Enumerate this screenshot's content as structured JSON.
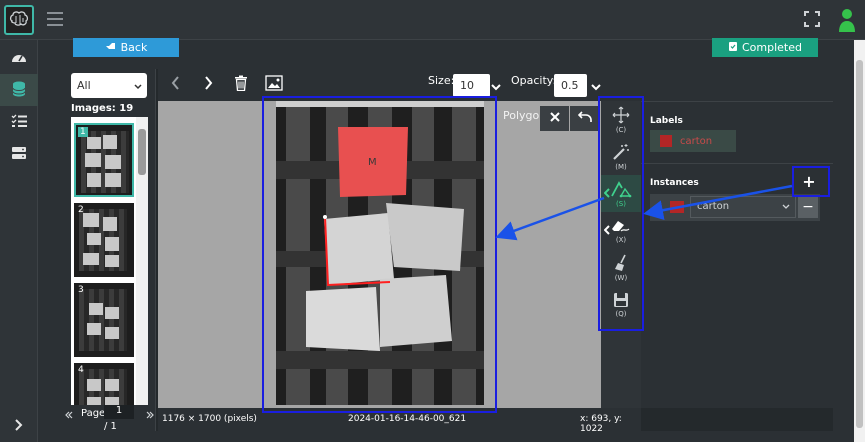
{
  "header": {
    "logo_icon": "brain-logo-icon",
    "menu_icon": "hamburger-icon",
    "fullscreen_icon": "fullscreen-icon",
    "user_icon": "user-icon"
  },
  "sidebar": {
    "items": [
      {
        "icon": "dashboard-icon"
      },
      {
        "icon": "database-icon",
        "active": true
      },
      {
        "icon": "task-list-icon"
      },
      {
        "icon": "server-icon"
      }
    ],
    "expand_icon": "chevron-right-icon"
  },
  "actions": {
    "back_label": "Back",
    "completed_label": "Completed"
  },
  "images_panel": {
    "filter_value": "All",
    "images_count_label": "Images: 19",
    "thumbnails": [
      {
        "num": "1"
      },
      {
        "num": "2"
      },
      {
        "num": "3"
      },
      {
        "num": "4"
      }
    ],
    "page_label": "Page",
    "page_value": "1",
    "page_total": "/ 1"
  },
  "toolbar": {
    "size_label": "Size:",
    "size_value": "10",
    "opacity_label": "Opacity:",
    "opacity_value": "0.5"
  },
  "canvas": {
    "polygon_label": "Polygon",
    "dimensions": "1176 × 1700 (pixels)",
    "filename": "2024-01-16-14-46-00_621",
    "coords": "x: 693, y: 1022"
  },
  "tools": [
    {
      "key": "(C)",
      "icon": "move-icon"
    },
    {
      "key": "(M)",
      "icon": "magic-wand-icon"
    },
    {
      "key": "(S)",
      "icon": "polygon-brush-icon",
      "active": true
    },
    {
      "key": "(X)",
      "icon": "eraser-icon"
    },
    {
      "key": "(W)",
      "icon": "broom-icon"
    },
    {
      "key": "(Q)",
      "icon": "save-icon"
    }
  ],
  "right_panel": {
    "labels_title": "Labels",
    "label_name": "carton",
    "label_color": "#b32626",
    "instances_title": "Instances",
    "instance_value": "carton"
  },
  "colors": {
    "accent": "#3fb8a8",
    "back": "#2e9ad8",
    "completed": "#1aa080",
    "highlight": "#1a1ee0"
  }
}
